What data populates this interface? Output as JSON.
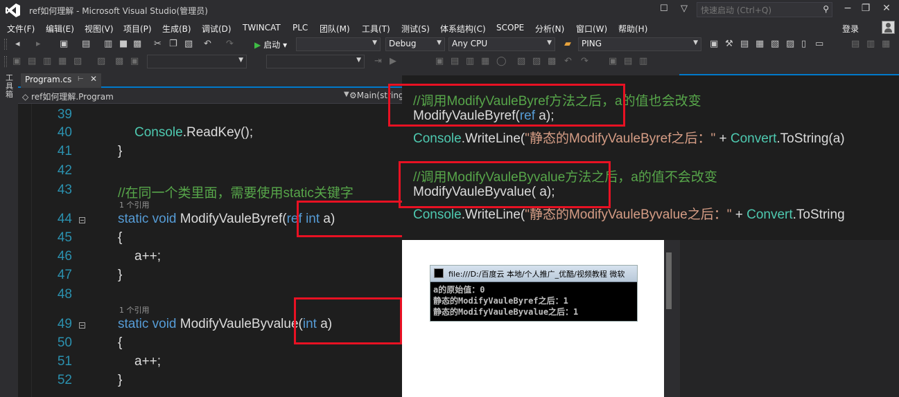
{
  "window": {
    "title": "ref如何理解 - Microsoft Visual Studio(管理员)",
    "quick_launch_placeholder": "快速启动 (Ctrl+Q)"
  },
  "menu": [
    "文件(F)",
    "编辑(E)",
    "视图(V)",
    "项目(P)",
    "生成(B)",
    "调试(D)",
    "TWINCAT",
    "PLC",
    "团队(M)",
    "工具(T)",
    "测试(S)",
    "体系结构(C)",
    "SCOPE",
    "分析(N)",
    "窗口(W)",
    "帮助(H)"
  ],
  "login": "登录",
  "toolbar": {
    "start": "启动",
    "config": "Debug",
    "platform": "Any CPU",
    "target": "PING"
  },
  "side_label": "工具箱",
  "tab": {
    "label": "Program.cs"
  },
  "nav": {
    "class": "ref如何理解.Program",
    "method": "Main(string"
  },
  "editor": {
    "lines": [
      {
        "no": "39"
      },
      {
        "no": "40",
        "tokens": [
          [
            "cls",
            "Console"
          ],
          [
            "",
            "."
          ],
          [
            "",
            "ReadKey();"
          ]
        ]
      },
      {
        "no": "41",
        "tokens": [
          [
            "",
            "}"
          ]
        ]
      },
      {
        "no": "42"
      },
      {
        "no": "43",
        "tokens": [
          [
            "cmt",
            "//在同一个类里面，需要使用static关键字"
          ]
        ]
      },
      {
        "no": "44",
        "hint": "1 个引用",
        "tokens": [
          [
            "kw",
            "static"
          ],
          [
            "",
            " "
          ],
          [
            "kw",
            "void"
          ],
          [
            "",
            " ModifyVauleByref("
          ],
          [
            "kw",
            "ref"
          ],
          [
            "",
            " "
          ],
          [
            "kw",
            "int"
          ],
          [
            "",
            " a)"
          ]
        ]
      },
      {
        "no": "45",
        "tokens": [
          [
            "",
            "{"
          ]
        ]
      },
      {
        "no": "46",
        "tokens": [
          [
            "",
            "a++;"
          ]
        ]
      },
      {
        "no": "47",
        "tokens": [
          [
            "",
            "}"
          ]
        ]
      },
      {
        "no": "48"
      },
      {
        "no": "49",
        "hint": "1 个引用",
        "tokens": [
          [
            "kw",
            "static"
          ],
          [
            "",
            " "
          ],
          [
            "kw",
            "void"
          ],
          [
            "",
            " ModifyVauleByvalue("
          ],
          [
            "kw",
            "int"
          ],
          [
            "",
            " a)"
          ]
        ]
      },
      {
        "no": "50",
        "tokens": [
          [
            "",
            "{"
          ]
        ]
      },
      {
        "no": "51",
        "tokens": [
          [
            "",
            "a++;"
          ]
        ]
      },
      {
        "no": "52",
        "tokens": [
          [
            "",
            "}"
          ]
        ]
      }
    ]
  },
  "code_overlay": {
    "lines": [
      {
        "tokens": [
          [
            "cmt",
            "//调用ModifyVauleByref方法之后，a的值也会改变"
          ]
        ]
      },
      {
        "tokens": [
          [
            "",
            "ModifyVauleByref("
          ],
          [
            "kw",
            "ref"
          ],
          [
            "",
            " a);"
          ]
        ]
      },
      {
        "tokens": [
          [
            "cls",
            "Console"
          ],
          [
            "",
            ".WriteLine("
          ],
          [
            "str",
            "\"静态的ModifyVauleByref之后：\""
          ],
          [
            "",
            " + "
          ],
          [
            "cls",
            "Convert"
          ],
          [
            "",
            ".ToString(a)"
          ]
        ]
      },
      {
        "tokens": [
          [
            "cmt",
            "//调用ModifyVauleByvalue方法之后，a的值不会改变"
          ]
        ]
      },
      {
        "tokens": [
          [
            "",
            "ModifyVauleByvalue( a);"
          ]
        ]
      },
      {
        "tokens": [
          [
            "cls",
            "Console"
          ],
          [
            "",
            ".WriteLine("
          ],
          [
            "str",
            "\"静态的ModifyVauleByvalue之后：\""
          ],
          [
            "",
            " + "
          ],
          [
            "cls",
            "Convert"
          ],
          [
            "",
            ".ToString"
          ]
        ]
      }
    ]
  },
  "console": {
    "title": "file:///D:/百度云 本地/个人推广_优酷/视频教程 微软",
    "lines": [
      "a的原始值：0",
      "静态的ModifyVauleByref之后：1",
      "静态的ModifyVauleByvalue之后：1"
    ]
  },
  "colors": {
    "keyword": "#569cd6",
    "class": "#4ec9b0",
    "comment": "#57a64a",
    "string": "#d69d85",
    "highlight_box": "#e81123",
    "accent": "#007acc"
  }
}
